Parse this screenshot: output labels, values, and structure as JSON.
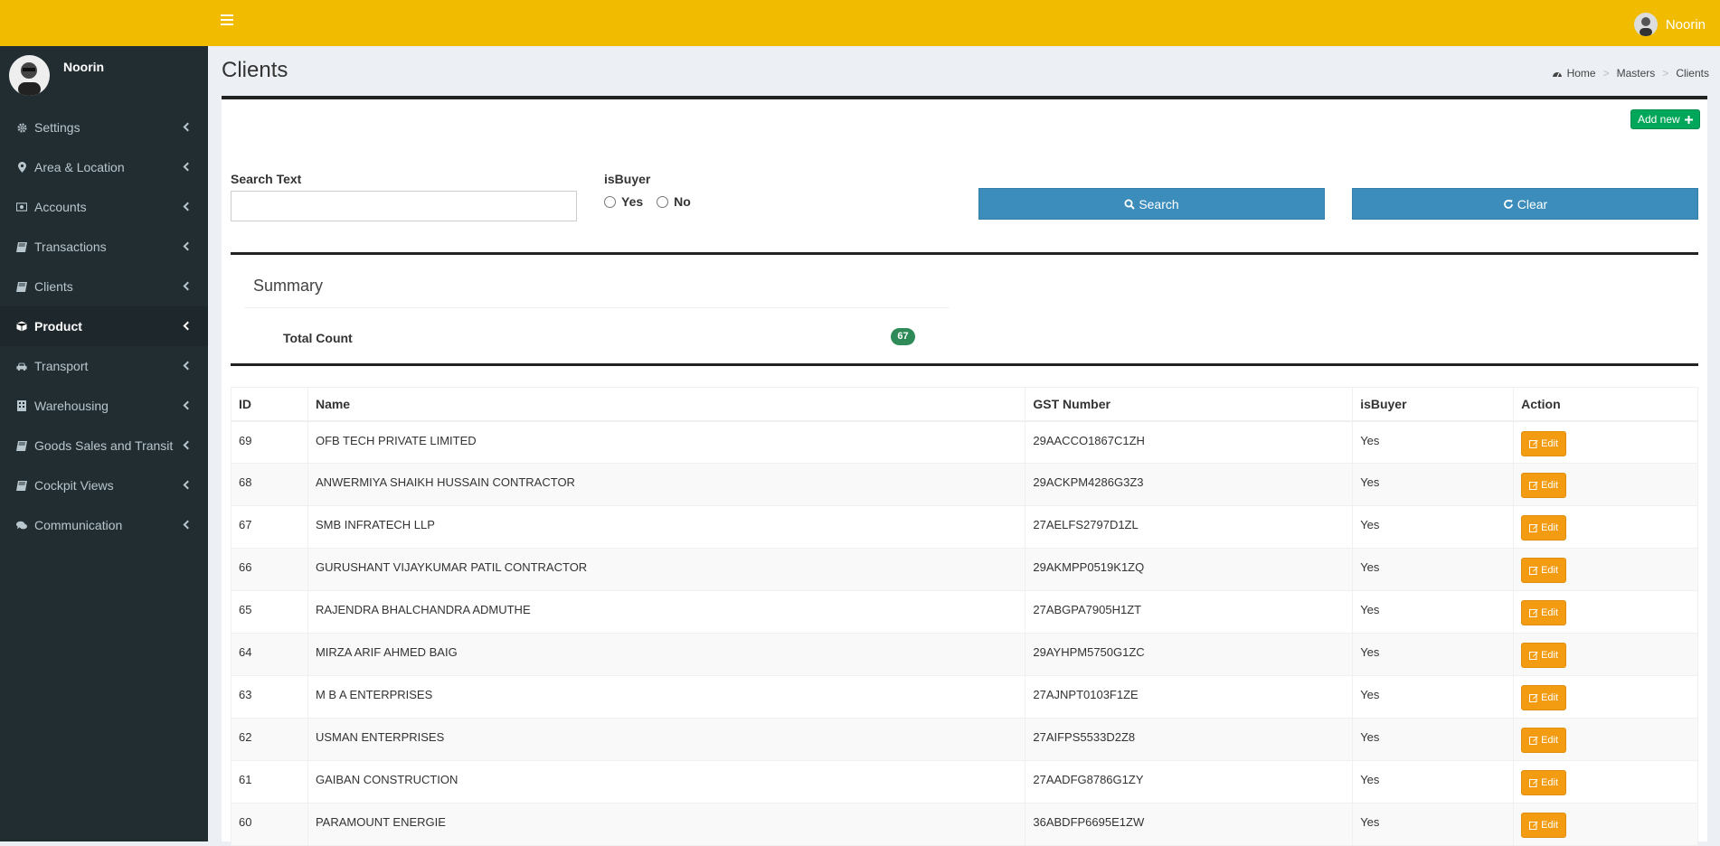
{
  "header": {
    "username": "Noorin"
  },
  "sidebar": {
    "username": "Noorin",
    "items": [
      {
        "label": "Settings",
        "icon": "gear-icon",
        "active": false
      },
      {
        "label": "Area & Location",
        "icon": "map-marker-icon",
        "active": false
      },
      {
        "label": "Accounts",
        "icon": "money-icon",
        "active": false
      },
      {
        "label": "Transactions",
        "icon": "book-icon",
        "active": false
      },
      {
        "label": "Clients",
        "icon": "book-icon",
        "active": false
      },
      {
        "label": "Product",
        "icon": "cube-icon",
        "active": true
      },
      {
        "label": "Transport",
        "icon": "car-icon",
        "active": false
      },
      {
        "label": "Warehousing",
        "icon": "building-icon",
        "active": false
      },
      {
        "label": "Goods Sales and Transit",
        "icon": "book-icon",
        "active": false
      },
      {
        "label": "Cockpit Views",
        "icon": "book-icon",
        "active": false
      },
      {
        "label": "Communication",
        "icon": "comments-icon",
        "active": false
      }
    ]
  },
  "page": {
    "title": "Clients",
    "breadcrumb": [
      "Home",
      "Masters",
      "Clients"
    ]
  },
  "toolbar": {
    "add_new_label": "Add new"
  },
  "filters": {
    "search_label": "Search Text",
    "search_value": "",
    "isbuyer_label": "isBuyer",
    "option_yes": "Yes",
    "option_no": "No",
    "search_button": "Search",
    "clear_button": "Clear"
  },
  "summary": {
    "title": "Summary",
    "total_label": "Total Count",
    "total_count": "67"
  },
  "table": {
    "columns": [
      "ID",
      "Name",
      "GST Number",
      "isBuyer",
      "Action"
    ],
    "edit_label": "Edit",
    "rows": [
      {
        "id": "69",
        "name": "OFB TECH PRIVATE LIMITED",
        "gst": "29AACCO1867C1ZH",
        "isbuyer": "Yes"
      },
      {
        "id": "68",
        "name": "ANWERMIYA SHAIKH HUSSAIN CONTRACTOR",
        "gst": "29ACKPM4286G3Z3",
        "isbuyer": "Yes"
      },
      {
        "id": "67",
        "name": "SMB INFRATECH LLP",
        "gst": "27AELFS2797D1ZL",
        "isbuyer": "Yes"
      },
      {
        "id": "66",
        "name": "GURUSHANT VIJAYKUMAR PATIL CONTRACTOR",
        "gst": "29AKMPP0519K1ZQ",
        "isbuyer": "Yes"
      },
      {
        "id": "65",
        "name": "RAJENDRA BHALCHANDRA ADMUTHE",
        "gst": "27ABGPA7905H1ZT",
        "isbuyer": "Yes"
      },
      {
        "id": "64",
        "name": "MIRZA ARIF AHMED BAIG",
        "gst": "29AYHPM5750G1ZC",
        "isbuyer": "Yes"
      },
      {
        "id": "63",
        "name": "M B A ENTERPRISES",
        "gst": "27AJNPT0103F1ZE",
        "isbuyer": "Yes"
      },
      {
        "id": "62",
        "name": "USMAN ENTERPRISES",
        "gst": "27AIFPS5533D2Z8",
        "isbuyer": "Yes"
      },
      {
        "id": "61",
        "name": "GAIBAN CONSTRUCTION",
        "gst": "27AADFG8786G1ZY",
        "isbuyer": "Yes"
      },
      {
        "id": "60",
        "name": "PARAMOUNT ENERGIE",
        "gst": "36ABDFP6695E1ZW",
        "isbuyer": "Yes"
      }
    ]
  }
}
